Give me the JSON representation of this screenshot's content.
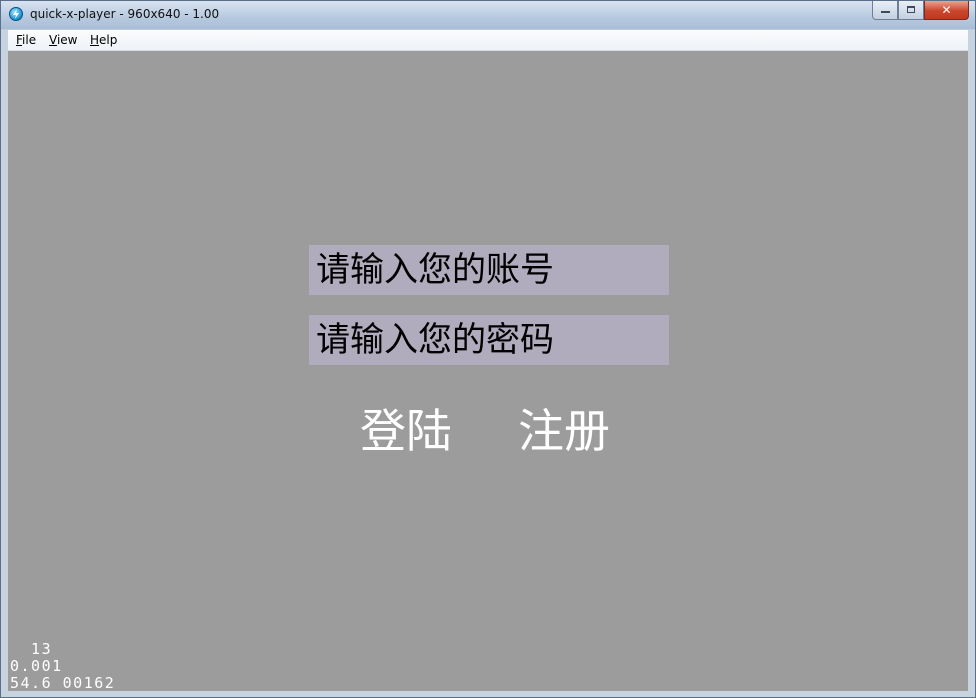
{
  "window": {
    "title": "quick-x-player - 960x640 - 1.00",
    "icon": "quick-x-player-logo-icon",
    "controls": {
      "minimize_icon": "minimize-icon",
      "maximize_icon": "maximize-icon",
      "close_icon": "close-icon",
      "close_glyph": "✕"
    }
  },
  "menubar": {
    "items": [
      {
        "label": "File"
      },
      {
        "label": "View"
      },
      {
        "label": "Help"
      }
    ]
  },
  "scene": {
    "background": "#9c9c9c",
    "account_field": {
      "placeholder": "请输入您的账号"
    },
    "password_field": {
      "placeholder": "请输入您的密码"
    },
    "login_button": {
      "label": "登陆"
    },
    "register_button": {
      "label": "注册"
    }
  },
  "stats": {
    "draw_calls": "  13",
    "frame_time": "0.001",
    "fps_line": "54.6 00162"
  },
  "colors": {
    "field_background": "#b0abbd",
    "button_text": "#ffffff",
    "close_button": "#c9462c"
  }
}
